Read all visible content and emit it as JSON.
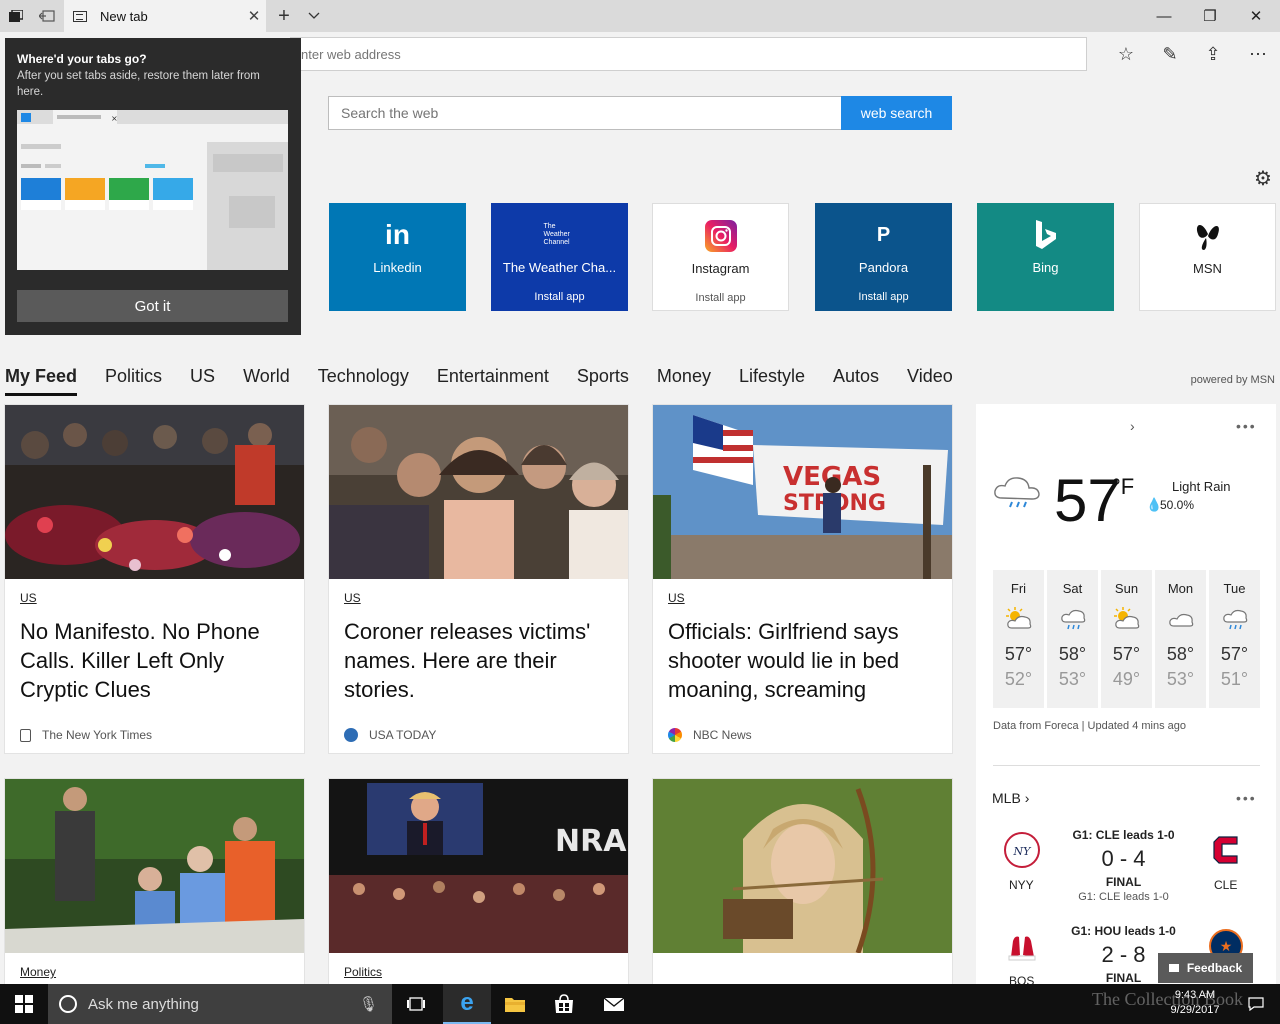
{
  "browser": {
    "tab_title": "New tab",
    "address_placeholder": "nter web address"
  },
  "popup": {
    "title": "Where'd your tabs go?",
    "description": "After you set tabs aside, restore them later from here.",
    "button": "Got it"
  },
  "search": {
    "placeholder": "Search the web",
    "button": "web search"
  },
  "top_sites": [
    {
      "name": "Linkedin",
      "install": "",
      "bg": "#0077b5",
      "fg": "#ffffff",
      "logo": "in"
    },
    {
      "name": "The Weather Cha...",
      "install": "Install app",
      "bg": "#0d3aa9",
      "fg": "#ffffff",
      "logo": "The Weather Channel"
    },
    {
      "name": "Instagram",
      "install": "Install app",
      "bg": "#ffffff",
      "fg": "#222222",
      "logo": "instagram"
    },
    {
      "name": "Pandora",
      "install": "Install app",
      "bg": "#0b548c",
      "fg": "#ffffff",
      "logo": "P"
    },
    {
      "name": "Bing",
      "install": "",
      "bg": "#138a84",
      "fg": "#ffffff",
      "logo": "b"
    },
    {
      "name": "MSN",
      "install": "",
      "bg": "#ffffff",
      "fg": "#222222",
      "logo": "msn"
    }
  ],
  "nav": {
    "items": [
      "My Feed",
      "Politics",
      "US",
      "World",
      "Technology",
      "Entertainment",
      "Sports",
      "Money",
      "Lifestyle",
      "Autos",
      "Video"
    ],
    "powered_by": "powered by MSN"
  },
  "cards": [
    {
      "category": "US",
      "title": "No Manifesto. No Phone Calls. Killer Left Only Cryptic Clues",
      "source": "The New York Times"
    },
    {
      "category": "US",
      "title": "Coroner releases victims' names. Here are their stories.",
      "source": "USA TODAY"
    },
    {
      "category": "US",
      "title": "Officials: Girlfriend says shooter would lie in bed moaning, screaming",
      "source": "NBC News"
    },
    {
      "category": "Money",
      "title": "",
      "source": ""
    },
    {
      "category": "Politics",
      "title": "",
      "source": "",
      "image_text": "NRA"
    },
    {
      "category": "",
      "title": "",
      "source": ""
    }
  ],
  "weather": {
    "temp": "57",
    "unit": "°F",
    "condition": "Light Rain",
    "precip": "50.0%",
    "forecast": [
      {
        "day": "Fri",
        "hi": "57°",
        "lo": "52°",
        "icon": "partly-sunny-icon"
      },
      {
        "day": "Sat",
        "hi": "58°",
        "lo": "53°",
        "icon": "rain-icon"
      },
      {
        "day": "Sun",
        "hi": "57°",
        "lo": "49°",
        "icon": "partly-sunny-icon"
      },
      {
        "day": "Mon",
        "hi": "58°",
        "lo": "53°",
        "icon": "cloud-icon"
      },
      {
        "day": "Tue",
        "hi": "57°",
        "lo": "51°",
        "icon": "rain-icon"
      }
    ],
    "source": "Data from Foreca | Updated 4 mins ago"
  },
  "mlb": {
    "title": "MLB",
    "games": [
      {
        "status": "G1: CLE leads 1-0",
        "score": "0 - 4",
        "final": "FINAL",
        "sub": "G1: CLE leads 1-0",
        "home": "NYY",
        "away": "CLE"
      },
      {
        "status": "G1: HOU leads 1-0",
        "score": "2 - 8",
        "final": "FINAL",
        "sub": "",
        "home": "BOS",
        "away": ""
      }
    ]
  },
  "feedback": "Feedback",
  "taskbar": {
    "search_text": "Ask me anything",
    "time": "9:43 AM",
    "date": "9/29/2017",
    "watermark": "The Collection Book"
  }
}
